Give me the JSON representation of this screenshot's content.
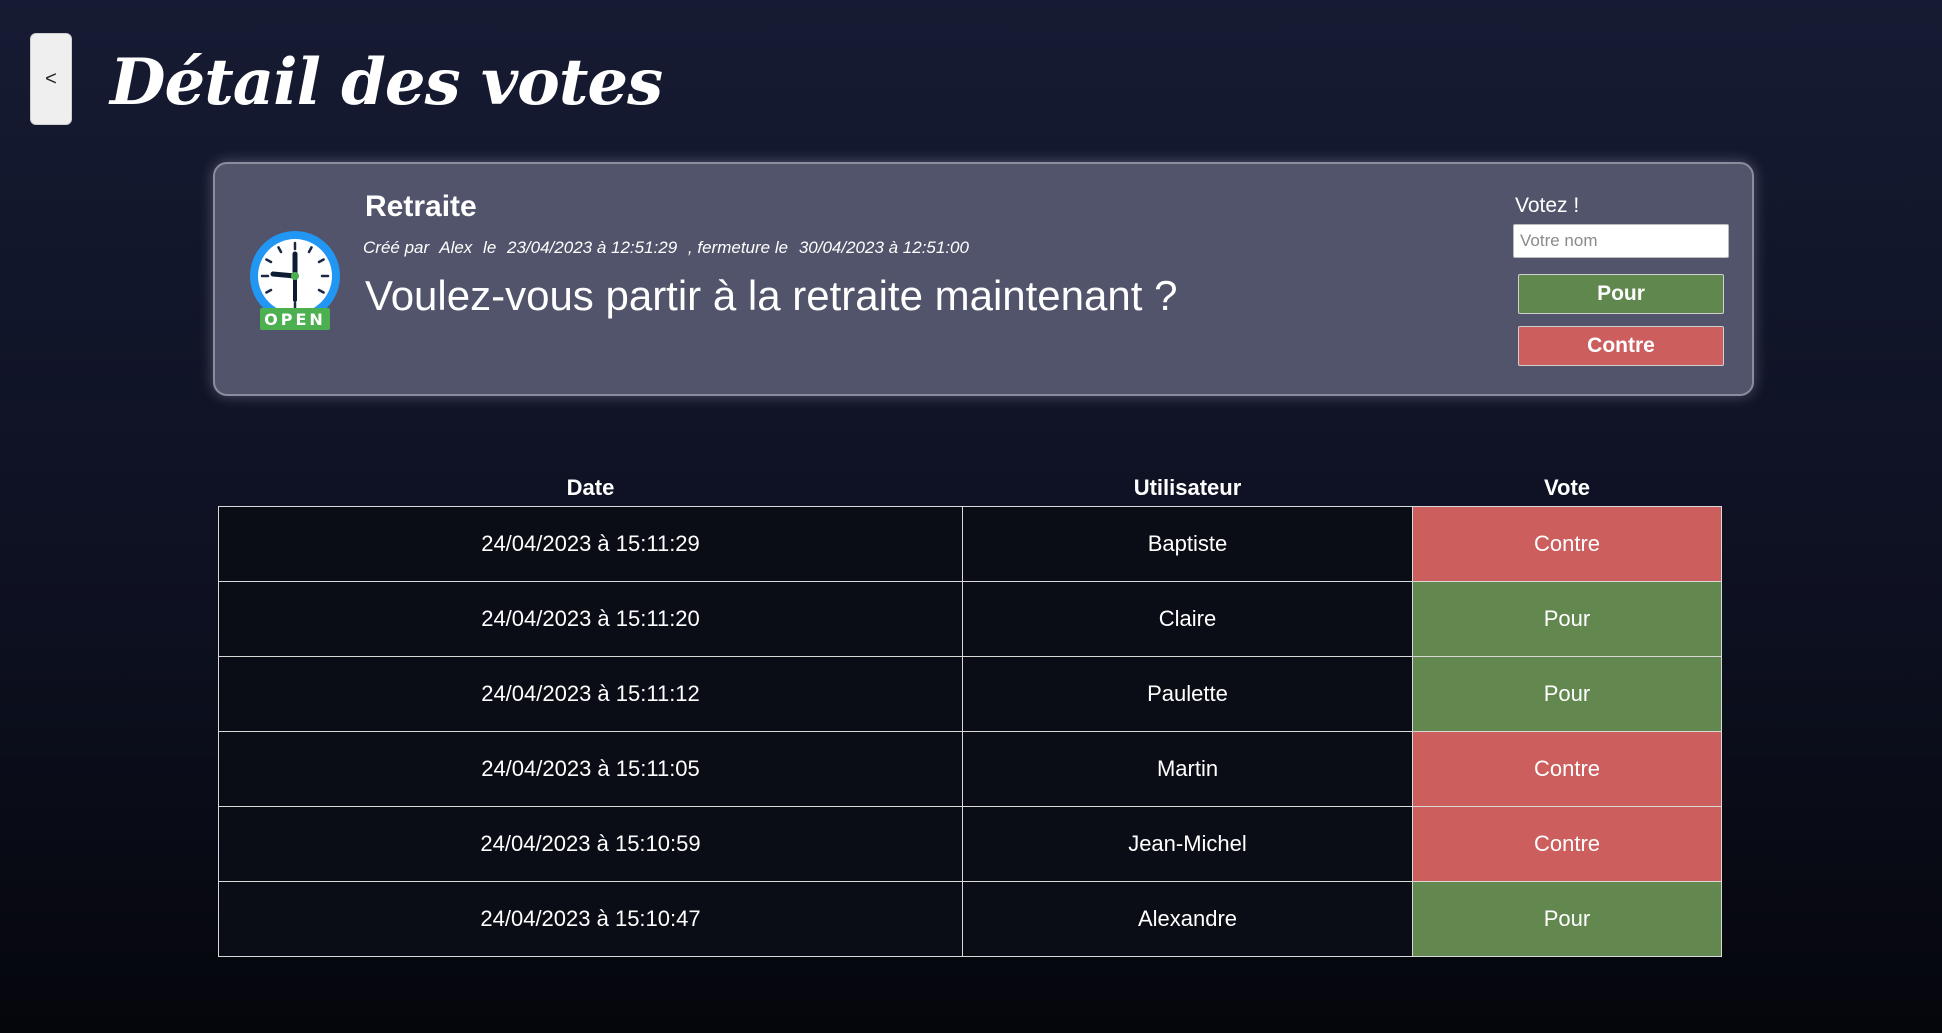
{
  "header": {
    "back_label": "<",
    "title": "Détail des votes"
  },
  "poll": {
    "title": "Retraite",
    "status_icon": "open-clock-icon",
    "status_text": "OPEN",
    "meta": {
      "created_by_label": "Créé par",
      "author": "Alex",
      "on_label": "le",
      "created_at": "23/04/2023 à 12:51:29",
      "closing_label": ", fermeture le",
      "closing_at": "30/04/2023 à 12:51:00"
    },
    "question": "Voulez-vous partir à la retraite maintenant ?",
    "vote_label": "Votez !",
    "name_placeholder": "Votre nom",
    "name_value": "",
    "pour_label": "Pour",
    "contre_label": "Contre"
  },
  "table": {
    "headers": [
      "Date",
      "Utilisateur",
      "Vote"
    ],
    "rows": [
      {
        "date": "24/04/2023 à 15:11:29",
        "user": "Baptiste",
        "vote": "Contre"
      },
      {
        "date": "24/04/2023 à 15:11:20",
        "user": "Claire",
        "vote": "Pour"
      },
      {
        "date": "24/04/2023 à 15:11:12",
        "user": "Paulette",
        "vote": "Pour"
      },
      {
        "date": "24/04/2023 à 15:11:05",
        "user": "Martin",
        "vote": "Contre"
      },
      {
        "date": "24/04/2023 à 15:10:59",
        "user": "Jean-Michel",
        "vote": "Contre"
      },
      {
        "date": "24/04/2023 à 15:10:47",
        "user": "Alexandre",
        "vote": "Pour"
      }
    ]
  },
  "colors": {
    "pour": "#62884f",
    "contre": "#cc5e5e",
    "card": "#51546a",
    "background": "#161b33"
  }
}
